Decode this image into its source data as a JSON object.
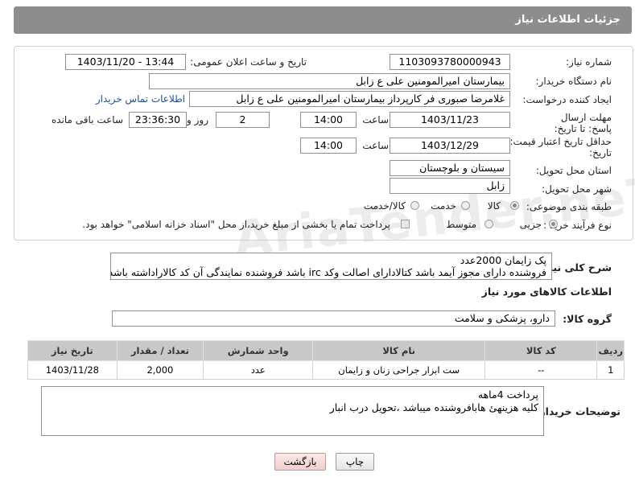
{
  "header": {
    "title": "جزئیات اطلاعات نیاز"
  },
  "labels": {
    "need_number": "شماره نیاز:",
    "announce_datetime": "تاریخ و ساعت اعلان عمومی:",
    "buyer_org": "نام دستگاه خریدار:",
    "requester": "ایجاد کننده درخواست:",
    "reply_deadline": "مهلت ارسال پاسخ: تا تاریخ:",
    "time": "ساعت",
    "day_and": "روز و",
    "remaining": "ساعت باقی مانده",
    "price_validity": "حداقل تاریخ اعتبار قیمت: تا تاریخ:",
    "time2": "ساعت",
    "delivery_province": "استان محل تحویل:",
    "delivery_city": "شهر محل تحویل:",
    "category": "طبقه بندی موضوعی:",
    "purchase_type": "نوع فرآیند خرید :",
    "general_desc": "شرح کلی نیاز:",
    "goods_info": "اطلاعات کالاهای مورد نیاز",
    "goods_group": "گروه کالا:",
    "buyer_notes": "توضیحات خریدار:"
  },
  "values": {
    "need_number": "1103093780000943",
    "announce_datetime": "1403/11/20 - 13:44",
    "buyer_org": "بیمارستان امیرالمومنین علی  ع  زابل",
    "requester": "غلامرضا صبوری فر کارپرداز بیمارستان امیرالمومنین علی  ع  زابل",
    "contact_link": "اطلاعات تماس خریدار",
    "reply_date": "1403/11/23",
    "reply_time": "14:00",
    "reply_days": "2",
    "remaining_time": "23:36:30",
    "validity_date": "1403/12/29",
    "validity_time": "14:00",
    "province": "سیستان و بلوچستان",
    "city": "زابل",
    "general_desc_line1": "پک زایمان 2000عدد",
    "general_desc_line2": "فروشنده دارای مجوز آیمد باشد کتالادارای اصالت وکد irc باشد فروشنده نمایندگی آن کد کالاراداشته باشد",
    "goods_group": "دارو، پزشکی و سلامت",
    "buyer_notes_line1": "پرداخت 4ماهه",
    "buyer_notes_line2": "کلیه هزینهئ هابافروشنده میباشد ،تحویل درب انبار"
  },
  "category_options": [
    {
      "label": "کالا",
      "checked": true
    },
    {
      "label": "خدمت",
      "checked": false
    },
    {
      "label": "کالا/خدمت",
      "checked": false
    }
  ],
  "purchase_options": [
    {
      "label": "جزیی",
      "checked": true
    },
    {
      "label": "متوسط",
      "checked": false
    }
  ],
  "payment_note": "پرداخت تمام یا بخشی از مبلغ خرید،از محل \"اسناد خزانه اسلامی\" خواهد بود.",
  "table": {
    "headers": [
      "ردیف",
      "کد کالا",
      "نام کالا",
      "واحد شمارش",
      "تعداد / مقدار",
      "تاریخ نیاز"
    ],
    "rows": [
      [
        "1",
        "--",
        "ست ابزار جراحی زنان و زایمان",
        "عدد",
        "2,000",
        "1403/11/28"
      ]
    ]
  },
  "buttons": {
    "print": "چاپ",
    "back": "بازگشت"
  },
  "watermark": "AriaTender.neT",
  "colors": {
    "header_bg": "#8d8d8d",
    "link": "#1a4fa0",
    "back_button_bg": "#f6d8d8"
  }
}
